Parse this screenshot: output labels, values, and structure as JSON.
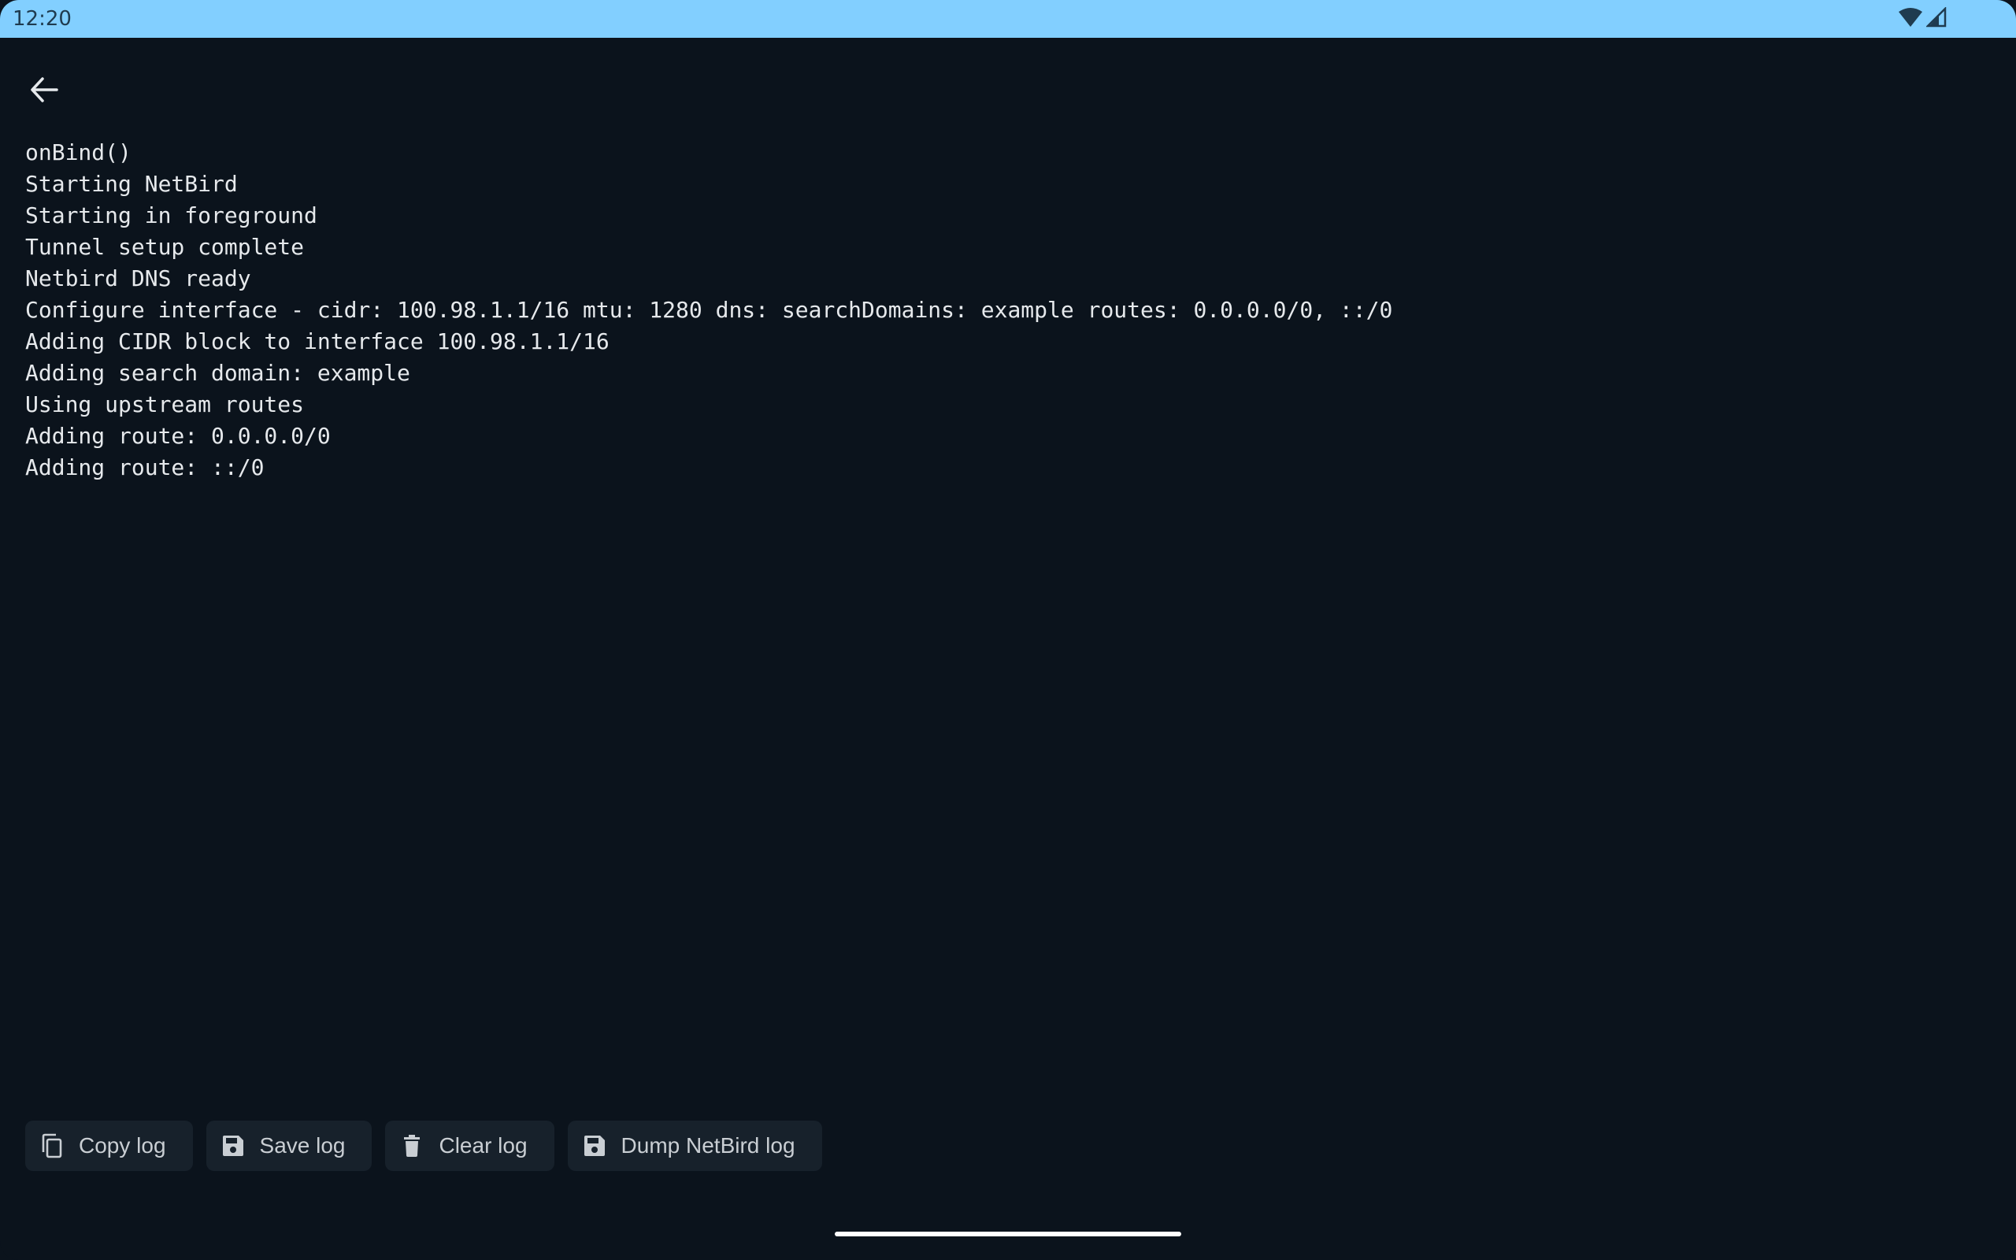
{
  "status_bar": {
    "time": "12:20",
    "icons": [
      "wifi-icon",
      "cell-signal-icon"
    ]
  },
  "toolbar": {
    "back_icon": "arrow-back-icon"
  },
  "log": {
    "lines": [
      "onBind()",
      "Starting NetBird",
      "Starting in foreground",
      "Tunnel setup complete",
      "Netbird DNS ready",
      "Configure interface - cidr: 100.98.1.1/16 mtu: 1280 dns: searchDomains: example routes: 0.0.0.0/0, ::/0",
      "Adding CIDR block to interface 100.98.1.1/16",
      "Adding search domain: example",
      "Using upstream routes",
      "Adding route: 0.0.0.0/0",
      "Adding route: ::/0"
    ]
  },
  "actions": {
    "copy_label": "Copy log",
    "save_label": "Save log",
    "clear_label": "Clear log",
    "dump_label": "Dump NetBird log"
  },
  "colors": {
    "background": "#0b131c",
    "status_bar": "#82cfff",
    "button_bg": "#17212b",
    "text": "#e6e9ec"
  }
}
